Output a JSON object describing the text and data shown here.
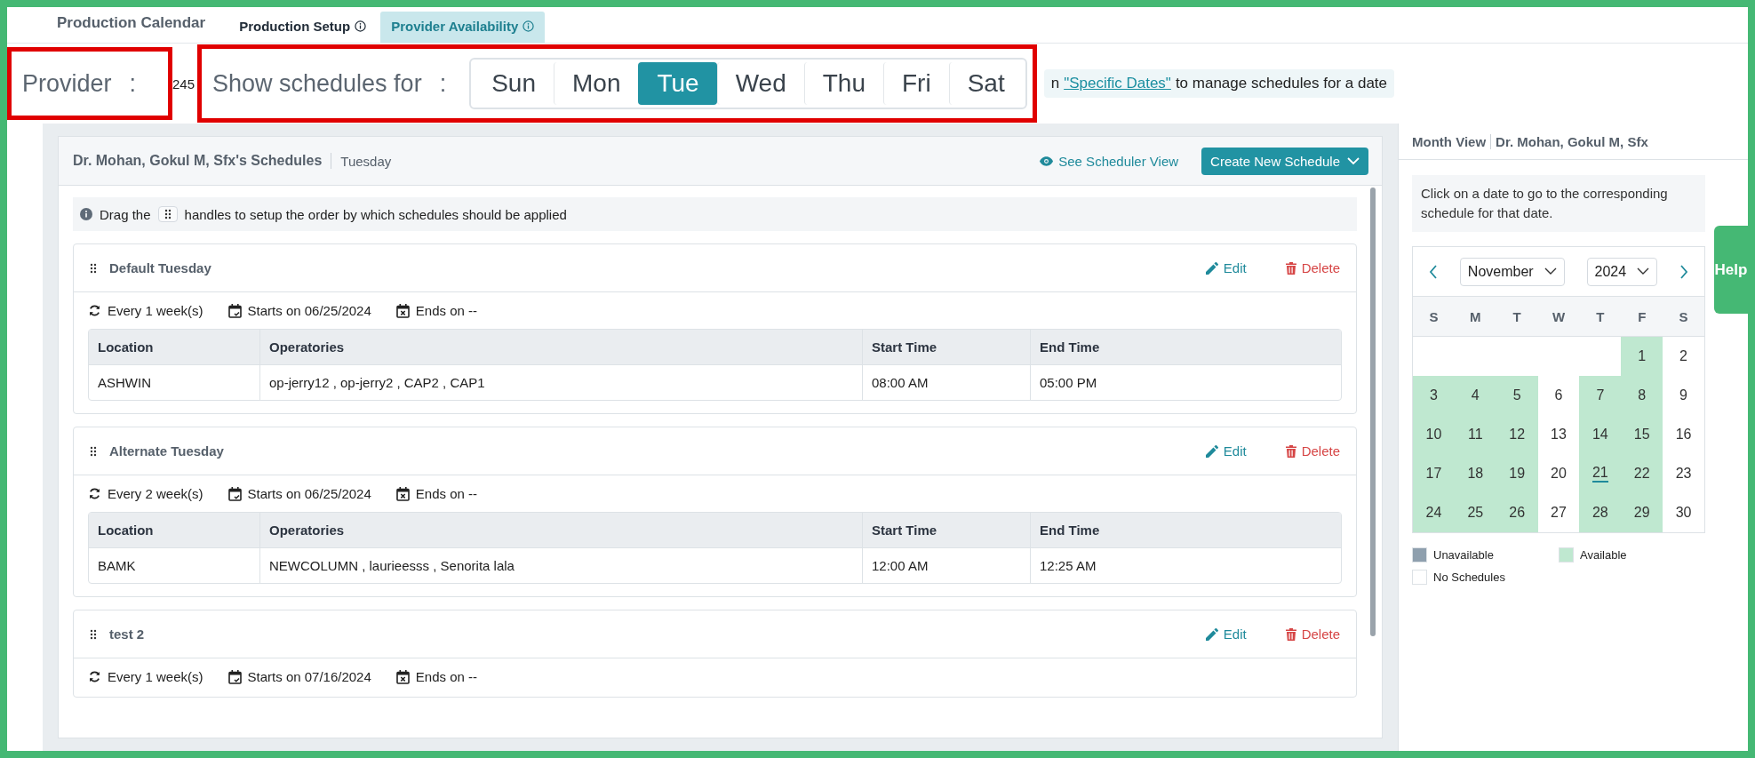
{
  "page_title": "Production Calendar",
  "tabs": [
    {
      "label": "Production Setup",
      "selected": false
    },
    {
      "label": "Provider Availability",
      "selected": true
    }
  ],
  "provider": {
    "label": "Provider",
    "colon": ":",
    "value": "245"
  },
  "show_schedules": {
    "label": "Show schedules for",
    "colon": ":",
    "days": [
      {
        "label": "Sun",
        "selected": false
      },
      {
        "label": "Mon",
        "selected": false
      },
      {
        "label": "Tue",
        "selected": true
      },
      {
        "label": "Wed",
        "selected": false
      },
      {
        "label": "Thu",
        "selected": false
      },
      {
        "label": "Fri",
        "selected": false
      },
      {
        "label": "Sat",
        "selected": false
      }
    ]
  },
  "hint": {
    "before": "n",
    "link": "\"Specific Dates\"",
    "after": "to manage schedules for a date"
  },
  "schedules_panel": {
    "title": "Dr. Mohan, Gokul M, Sfx's Schedules",
    "day": "Tuesday",
    "view_link": "See Scheduler View",
    "create_button": "Create New Schedule",
    "info": {
      "before": "Drag the",
      "after": "handles to setup the order by which schedules should be applied"
    },
    "schedules": [
      {
        "name": "Default Tuesday",
        "edit": "Edit",
        "delete": "Delete",
        "repeat": "Every 1 week(s)",
        "starts": "Starts on 06/25/2024",
        "ends": "Ends on --",
        "columns": [
          "Location",
          "Operatories",
          "Start Time",
          "End Time"
        ],
        "rows": [
          [
            "ASHWIN",
            "op-jerry12 ,  op-jerry2 ,  CAP2 ,  CAP1",
            "08:00 AM",
            "05:00 PM"
          ]
        ]
      },
      {
        "name": "Alternate Tuesday",
        "edit": "Edit",
        "delete": "Delete",
        "repeat": "Every 2 week(s)",
        "starts": "Starts on 06/25/2024",
        "ends": "Ends on --",
        "columns": [
          "Location",
          "Operatories",
          "Start Time",
          "End Time"
        ],
        "rows": [
          [
            "BAMK",
            "NEWCOLUMN ,  laurieesss ,  Senorita lala",
            "12:00 AM",
            "12:25 AM"
          ]
        ]
      },
      {
        "name": "test 2",
        "edit": "Edit",
        "delete": "Delete",
        "repeat": "Every 1 week(s)",
        "starts": "Starts on 07/16/2024",
        "ends": "Ends on --"
      }
    ]
  },
  "month_view": {
    "title": "Month View",
    "provider": "Dr. Mohan, Gokul M, Sfx",
    "note": "Click on a date to go to the corresponding schedule for that date.",
    "month": "November",
    "year": "2024",
    "weekdays": [
      "S",
      "M",
      "T",
      "W",
      "T",
      "F",
      "S"
    ],
    "weeks": [
      [
        {
          "kind": "blank"
        },
        {
          "kind": "blank"
        },
        {
          "kind": "blank"
        },
        {
          "kind": "blank"
        },
        {
          "kind": "blank"
        },
        {
          "kind": "day",
          "day": "1",
          "available": true,
          "today": false
        },
        {
          "kind": "day",
          "day": "2",
          "available": false,
          "today": false
        }
      ],
      [
        {
          "kind": "day",
          "day": "3",
          "available": true,
          "today": false
        },
        {
          "kind": "day",
          "day": "4",
          "available": true,
          "today": false
        },
        {
          "kind": "day",
          "day": "5",
          "available": true,
          "today": false
        },
        {
          "kind": "day",
          "day": "6",
          "available": false,
          "today": false
        },
        {
          "kind": "day",
          "day": "7",
          "available": true,
          "today": false
        },
        {
          "kind": "day",
          "day": "8",
          "available": true,
          "today": false
        },
        {
          "kind": "day",
          "day": "9",
          "available": false,
          "today": false
        }
      ],
      [
        {
          "kind": "day",
          "day": "10",
          "available": true,
          "today": false
        },
        {
          "kind": "day",
          "day": "11",
          "available": true,
          "today": false
        },
        {
          "kind": "day",
          "day": "12",
          "available": true,
          "today": false
        },
        {
          "kind": "day",
          "day": "13",
          "available": false,
          "today": false
        },
        {
          "kind": "day",
          "day": "14",
          "available": true,
          "today": false
        },
        {
          "kind": "day",
          "day": "15",
          "available": true,
          "today": false
        },
        {
          "kind": "day",
          "day": "16",
          "available": false,
          "today": false
        }
      ],
      [
        {
          "kind": "day",
          "day": "17",
          "available": true,
          "today": false
        },
        {
          "kind": "day",
          "day": "18",
          "available": true,
          "today": false
        },
        {
          "kind": "day",
          "day": "19",
          "available": true,
          "today": false
        },
        {
          "kind": "day",
          "day": "20",
          "available": false,
          "today": false
        },
        {
          "kind": "day",
          "day": "21",
          "available": true,
          "today": true
        },
        {
          "kind": "day",
          "day": "22",
          "available": true,
          "today": false
        },
        {
          "kind": "day",
          "day": "23",
          "available": false,
          "today": false
        }
      ],
      [
        {
          "kind": "day",
          "day": "24",
          "available": true,
          "today": false
        },
        {
          "kind": "day",
          "day": "25",
          "available": true,
          "today": false
        },
        {
          "kind": "day",
          "day": "26",
          "available": true,
          "today": false
        },
        {
          "kind": "day",
          "day": "27",
          "available": false,
          "today": false
        },
        {
          "kind": "day",
          "day": "28",
          "available": true,
          "today": false
        },
        {
          "kind": "day",
          "day": "29",
          "available": true,
          "today": false
        },
        {
          "kind": "day",
          "day": "30",
          "available": false,
          "today": false
        }
      ]
    ],
    "legend": [
      {
        "label": "Unavailable",
        "color": "#8fa0ae"
      },
      {
        "label": "Available",
        "color": "#bfe8d0"
      },
      {
        "label": "No Schedules",
        "color": "#ffffff"
      }
    ]
  },
  "help_tab": "Help"
}
